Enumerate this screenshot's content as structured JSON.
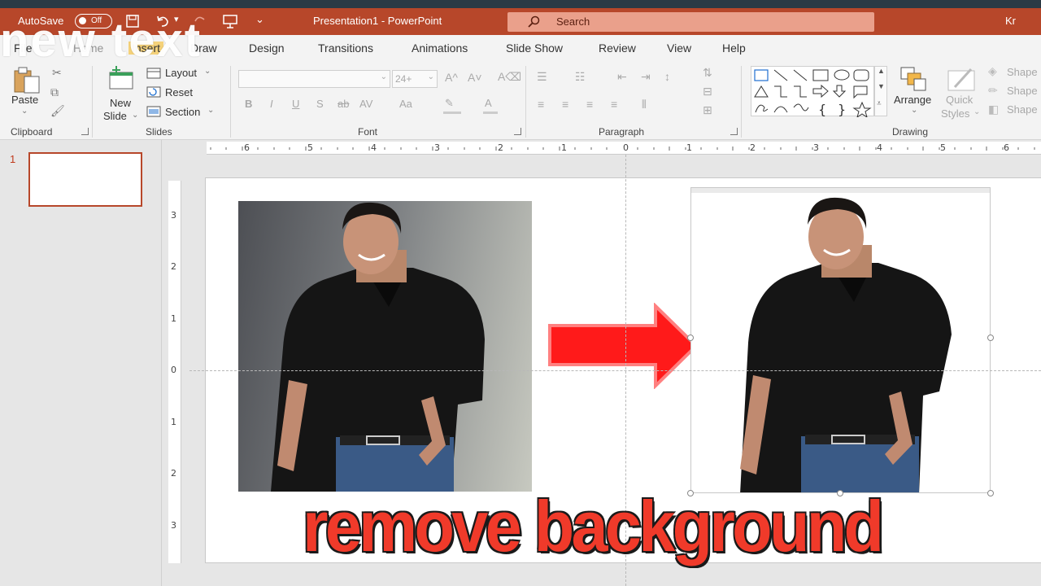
{
  "titlebar": {
    "autosave_label": "AutoSave",
    "autosave_state": "Off",
    "title": "Presentation1  -  PowerPoint",
    "search_placeholder": "Search",
    "user_initials": "Kr"
  },
  "tabs": [
    "File",
    "Home",
    "Insert",
    "Draw",
    "Design",
    "Transitions",
    "Animations",
    "Slide Show",
    "Review",
    "View",
    "Help"
  ],
  "tab_positions_note": "",
  "ribbon": {
    "clipboard": {
      "label": "Clipboard",
      "paste": "Paste"
    },
    "slides": {
      "label": "Slides",
      "new_slide_1": "New",
      "new_slide_2": "Slide",
      "layout": "Layout",
      "reset": "Reset",
      "section": "Section"
    },
    "font": {
      "label": "Font",
      "size": "24+",
      "bold": "B",
      "italic": "I",
      "underline": "U",
      "strike": "S",
      "aa_up": "A",
      "aa_case": "Aa",
      "font_color": "A"
    },
    "paragraph": {
      "label": "Paragraph"
    },
    "drawing": {
      "label": "Drawing",
      "arrange": "Arrange",
      "quick_1": "Quick",
      "quick_2": "Styles",
      "shape_fill": "Shape",
      "shape_outline": "Shape",
      "shape_effects": "Shape"
    }
  },
  "thumbnail": {
    "number": "1"
  },
  "ruler": {
    "h": [
      "6",
      "5",
      "4",
      "3",
      "2",
      "1",
      "0",
      "1",
      "2",
      "3",
      "4",
      "5",
      "6"
    ],
    "v": [
      "3",
      "2",
      "1",
      "0",
      "1",
      "2",
      "3"
    ]
  },
  "overlay": {
    "top_text": "new text",
    "headline": "remove background"
  },
  "colors": {
    "accent": "#b7472a",
    "headline": "#f03a2a",
    "arrow": "#ff1a1a"
  }
}
